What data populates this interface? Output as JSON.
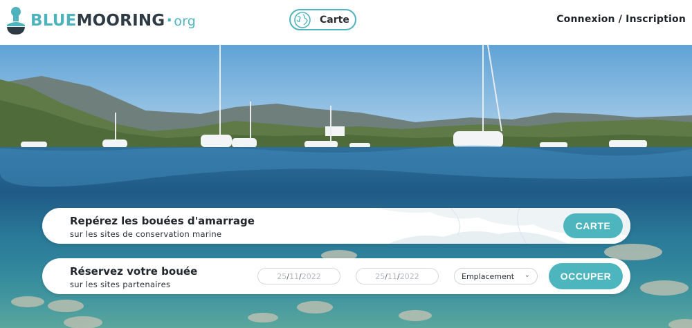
{
  "header": {
    "logo_blue": "BLUE",
    "logo_mooring": "MOORING",
    "logo_dot": "·",
    "logo_org": "org",
    "map_tab_label": "Carte",
    "login_label": "Connexion / Inscription"
  },
  "card_locate": {
    "title": "Repérez les bouées d'amarrage",
    "subtitle": "sur les sites de conservation marine",
    "button_label": "CARTE"
  },
  "card_book": {
    "title": "Réservez votre bouée",
    "subtitle": "sur les sites partenaires",
    "date_from": {
      "day": "25",
      "month": "11",
      "year": "2022"
    },
    "date_to": {
      "day": "25",
      "month": "11",
      "year": "2022"
    },
    "location_select": "Emplacement",
    "button_label": "OCCUPER"
  },
  "colors": {
    "accent": "#4fb3bd",
    "dark_text": "#20262c"
  },
  "icons": {
    "logo": "mooring-buoy-icon",
    "map_tab": "globe-icon",
    "select": "chevron-down-icon"
  }
}
